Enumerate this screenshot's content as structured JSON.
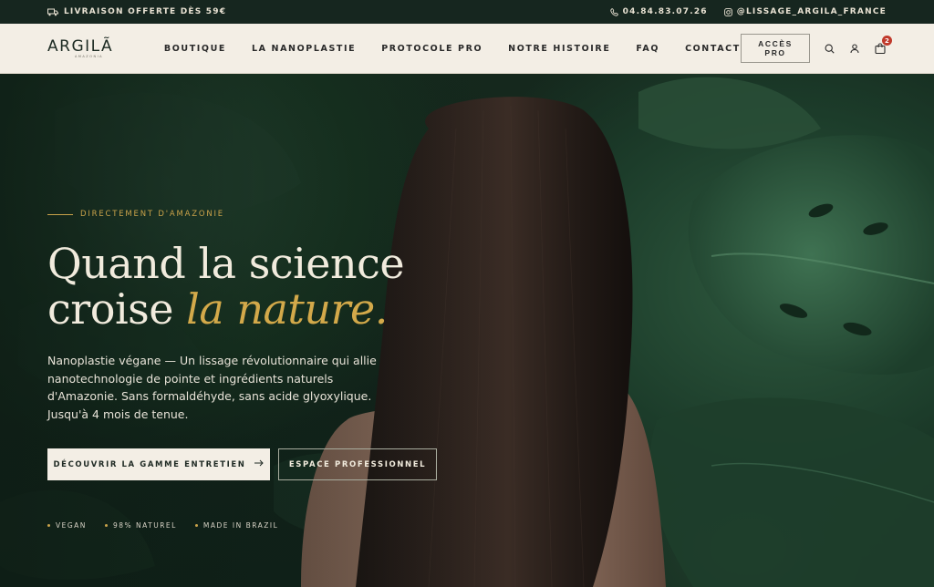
{
  "topbar": {
    "shipping": "LIVRAISON OFFERTE DÈS 59€",
    "phone": "04.84.83.07.26",
    "instagram": "@LISSAGE_ARGILA_FRANCE"
  },
  "header": {
    "logo": "ARGILÃ",
    "logo_sub": "AMAZONIA",
    "nav": [
      "BOUTIQUE",
      "LA NANOPLASTIE",
      "PROTOCOLE PRO",
      "NOTRE HISTOIRE",
      "FAQ",
      "CONTACT"
    ],
    "pro_button": "ACCÈS PRO",
    "cart_count": "2"
  },
  "hero": {
    "eyebrow": "DIRECTEMENT D'AMAZONIE",
    "headline_line1": "Quand la science",
    "headline_line2": "croise ",
    "headline_accent": "la nature.",
    "lead": "Nanoplastie végane — Un lissage révolutionnaire qui allie nanotechnologie de pointe et ingrédients naturels d'Amazonie. Sans formaldéhyde, sans acide glyoxylique. Jusqu'à 4 mois de tenue.",
    "cta_primary": "DÉCOUVRIR LA GAMME ENTRETIEN",
    "cta_secondary": "ESPACE PROFESSIONNEL",
    "badges": [
      "VEGAN",
      "98% NATUREL",
      "MADE IN BRAZIL"
    ]
  },
  "icons": {
    "shipping": "truck-icon",
    "phone": "phone-icon",
    "instagram": "instagram-icon",
    "search": "search-icon",
    "account": "user-icon",
    "cart": "shopping-bag-icon",
    "arrow": "arrow-right-icon"
  },
  "colors": {
    "accent_gold": "#d3a94a",
    "dark_green": "#16261f",
    "cream": "#f3eee5",
    "badge_red": "#c0392b"
  }
}
